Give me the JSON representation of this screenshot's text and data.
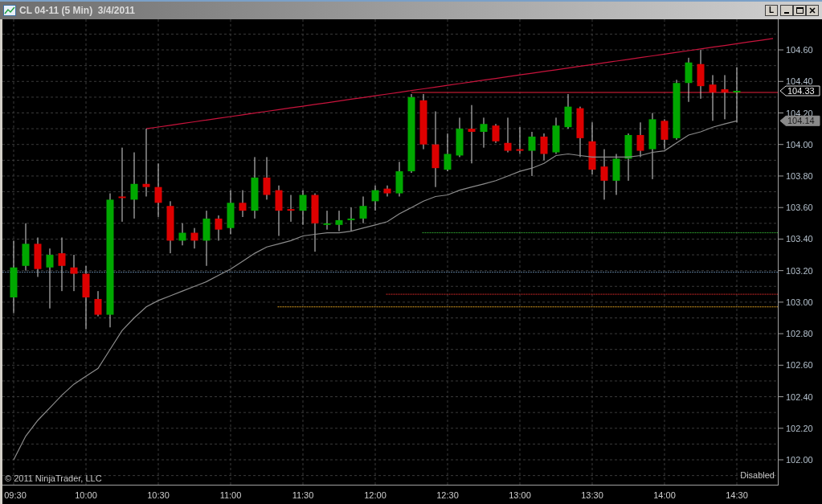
{
  "window": {
    "title": "CL 04-11 (5 Min)  3/4/2011",
    "buttons": [
      {
        "kind": "text",
        "label": "L"
      },
      {
        "kind": "minimize"
      },
      {
        "kind": "maximize"
      },
      {
        "kind": "close"
      }
    ]
  },
  "chart": {
    "copyright": "© 2011 NinjaTrader, LLC",
    "status": "Disabled",
    "chart_data": {
      "type": "candlestick",
      "grid": true,
      "ylim": [
        101.842,
        104.794
      ],
      "categories": [
        "09:30",
        null,
        null,
        null,
        null,
        null,
        "10:00",
        null,
        null,
        null,
        null,
        null,
        "10:30",
        null,
        null,
        null,
        null,
        null,
        "11:00",
        null,
        null,
        null,
        null,
        null,
        "11:30",
        null,
        null,
        null,
        null,
        null,
        "12:00",
        null,
        null,
        null,
        null,
        null,
        "12:30",
        null,
        null,
        null,
        null,
        null,
        "13:00",
        null,
        null,
        null,
        null,
        null,
        "13:30",
        null,
        null,
        null,
        null,
        null,
        "14:00",
        null,
        null,
        null,
        null,
        null,
        "14:30",
        null,
        null,
        null
      ],
      "yticks": [
        {
          "value": 102,
          "label": "102.00"
        },
        {
          "value": 102.2,
          "label": "102.20"
        },
        {
          "value": 102.4,
          "label": "102.40"
        },
        {
          "value": 102.6,
          "label": "102.60"
        },
        {
          "value": 102.8,
          "label": "102.80"
        },
        {
          "value": 103,
          "label": "103.00"
        },
        {
          "value": 103.2,
          "label": "103.20"
        },
        {
          "value": 103.4,
          "label": "103.40"
        },
        {
          "value": 103.6,
          "label": "103.60"
        },
        {
          "value": 103.8,
          "label": "103.80"
        },
        {
          "value": 104,
          "label": "104.00"
        },
        {
          "value": 104.2,
          "label": "104.20"
        },
        {
          "value": 104.4,
          "label": "104.40"
        },
        {
          "value": 104.6,
          "label": "104.60"
        }
      ],
      "ohlc": [
        [
          103.03,
          103.39,
          102.93,
          103.22
        ],
        [
          103.23,
          103.5,
          103.2,
          103.37
        ],
        [
          103.37,
          103.41,
          103.16,
          103.21
        ],
        [
          103.22,
          103.34,
          102.96,
          103.3
        ],
        [
          103.31,
          103.41,
          103.07,
          103.23
        ],
        [
          103.22,
          103.3,
          103.07,
          103.18
        ],
        [
          103.18,
          103.23,
          102.83,
          103.03
        ],
        [
          103.02,
          103.07,
          102.91,
          102.92
        ],
        [
          102.92,
          103.69,
          102.84,
          103.65
        ],
        [
          103.67,
          103.98,
          103.51,
          103.66
        ],
        [
          103.65,
          103.95,
          103.53,
          103.75
        ],
        [
          103.75,
          104.1,
          103.67,
          103.73
        ],
        [
          103.73,
          103.88,
          103.54,
          103.63
        ],
        [
          103.61,
          103.64,
          103.31,
          103.39
        ],
        [
          103.39,
          103.5,
          103.36,
          103.44
        ],
        [
          103.44,
          103.47,
          103.34,
          103.39
        ],
        [
          103.39,
          103.58,
          103.23,
          103.53
        ],
        [
          103.53,
          103.55,
          103.39,
          103.46
        ],
        [
          103.47,
          103.71,
          103.43,
          103.63
        ],
        [
          103.63,
          103.71,
          103.54,
          103.58
        ],
        [
          103.58,
          103.92,
          103.53,
          103.79
        ],
        [
          103.79,
          103.92,
          103.65,
          103.68
        ],
        [
          103.71,
          103.74,
          103.42,
          103.58
        ],
        [
          103.59,
          103.68,
          103.51,
          103.58
        ],
        [
          103.58,
          103.71,
          103.49,
          103.68
        ],
        [
          103.68,
          103.69,
          103.32,
          103.5
        ],
        [
          103.49,
          103.58,
          103.46,
          103.5
        ],
        [
          103.49,
          103.58,
          103.45,
          103.52
        ],
        [
          103.52,
          103.6,
          103.45,
          103.53
        ],
        [
          103.53,
          103.67,
          103.5,
          103.61
        ],
        [
          103.64,
          103.74,
          103.58,
          103.71
        ],
        [
          103.72,
          103.74,
          103.67,
          103.69
        ],
        [
          103.69,
          103.89,
          103.67,
          103.83
        ],
        [
          103.83,
          104.32,
          103.82,
          104.3
        ],
        [
          104.28,
          104.32,
          103.97,
          104.0
        ],
        [
          104.0,
          104.21,
          103.73,
          103.85
        ],
        [
          103.84,
          104.07,
          103.83,
          103.94
        ],
        [
          103.93,
          104.17,
          103.92,
          104.1
        ],
        [
          104.1,
          104.25,
          103.88,
          104.08
        ],
        [
          104.08,
          104.17,
          103.98,
          104.13
        ],
        [
          104.12,
          104.13,
          104.01,
          104.02
        ],
        [
          104.01,
          104.17,
          103.95,
          103.96
        ],
        [
          103.97,
          104.11,
          103.94,
          103.96
        ],
        [
          103.96,
          104.08,
          103.8,
          104.05
        ],
        [
          104.05,
          104.07,
          103.9,
          103.94
        ],
        [
          103.95,
          104.17,
          103.94,
          104.12
        ],
        [
          104.11,
          104.32,
          104.1,
          104.24
        ],
        [
          104.23,
          104.24,
          103.92,
          104.04
        ],
        [
          104.02,
          104.14,
          103.81,
          103.84
        ],
        [
          103.86,
          103.97,
          103.65,
          103.77
        ],
        [
          103.77,
          103.94,
          103.68,
          103.91
        ],
        [
          103.91,
          104.07,
          103.77,
          104.06
        ],
        [
          104.06,
          104.14,
          103.92,
          103.96
        ],
        [
          103.97,
          104.2,
          103.78,
          104.16
        ],
        [
          104.15,
          104.16,
          103.97,
          104.03
        ],
        [
          104.04,
          104.41,
          104.03,
          104.39
        ],
        [
          104.39,
          104.55,
          104.27,
          104.52
        ],
        [
          104.51,
          104.6,
          104.29,
          104.37
        ],
        [
          104.38,
          104.44,
          104.15,
          104.33
        ],
        [
          104.35,
          104.44,
          104.16,
          104.33
        ],
        [
          104.33,
          104.49,
          104.14,
          104.34
        ],
        null,
        null,
        null
      ],
      "series": [
        {
          "type": "line",
          "color": "#8c8c8c",
          "values": [
            102.0,
            102.15,
            102.25,
            102.33,
            102.41,
            102.48,
            102.53,
            102.58,
            102.7,
            102.82,
            102.9,
            102.97,
            103.01,
            103.04,
            103.07,
            103.1,
            103.13,
            103.17,
            103.21,
            103.26,
            103.31,
            103.35,
            103.37,
            103.39,
            103.42,
            103.43,
            103.44,
            103.44,
            103.45,
            103.47,
            103.49,
            103.51,
            103.56,
            103.6,
            103.64,
            103.67,
            103.68,
            103.71,
            103.73,
            103.75,
            103.77,
            103.8,
            103.83,
            103.85,
            103.88,
            103.93,
            103.94,
            103.93,
            103.92,
            103.92,
            103.92,
            103.92,
            103.93,
            103.95,
            103.96,
            104.01,
            104.06,
            104.08,
            104.11,
            104.13,
            104.15,
            null,
            null,
            null
          ]
        },
        {
          "type": "line",
          "color": "#c8143c",
          "values": [
            null,
            null,
            null,
            null,
            null,
            null,
            null,
            null,
            null,
            null,
            null,
            104.1,
            104.111,
            104.122,
            104.133,
            104.144,
            104.155,
            104.166,
            104.177,
            104.188,
            104.199,
            104.21,
            104.221,
            104.232,
            104.243,
            104.254,
            104.265,
            104.276,
            104.287,
            104.298,
            104.309,
            104.32,
            104.331,
            104.342,
            104.353,
            104.364,
            104.375,
            104.386,
            104.397,
            104.408,
            104.419,
            104.43,
            104.441,
            104.452,
            104.463,
            104.474,
            104.485,
            104.496,
            104.507,
            104.518,
            104.529,
            104.54,
            104.551,
            104.562,
            104.573,
            104.584,
            104.595,
            104.606,
            104.617,
            104.628,
            104.639,
            104.65,
            104.661,
            104.672
          ]
        }
      ],
      "ref_lines": [
        {
          "axis": "y",
          "value": 104.33,
          "color": "#e8203c"
        },
        {
          "axis": "y",
          "value": 103.19,
          "color": "#5a7896"
        },
        {
          "axis": "y",
          "value": 103.44,
          "color": "#2e9e2e"
        },
        {
          "axis": "y",
          "value": 103.05,
          "color": "#d02828"
        },
        {
          "axis": "y",
          "value": 102.97,
          "color": "#e0a020"
        }
      ],
      "annotations": [
        "104.33",
        "104.14"
      ]
    }
  }
}
